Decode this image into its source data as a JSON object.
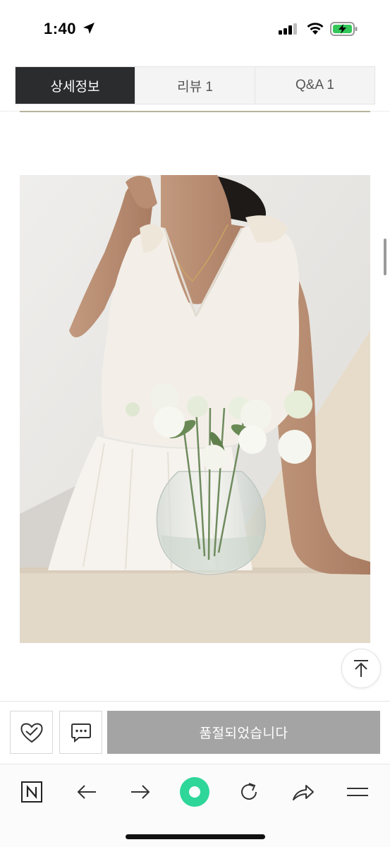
{
  "status_bar": {
    "time": "1:40",
    "icons": [
      "location-arrow-icon",
      "cellular-signal-icon",
      "wifi-icon",
      "battery-charging-icon"
    ]
  },
  "tabs": [
    {
      "label": "상세정보",
      "active": true
    },
    {
      "label": "리뷰 1",
      "active": false
    },
    {
      "label": "Q&A 1",
      "active": false
    }
  ],
  "purchase_bar": {
    "wish_icon": "heart-check-icon",
    "talk_icon": "chat-bubble-icon",
    "button_label": "품절되었습니다"
  },
  "scroll_top_icon": "arrow-up-to-top-icon",
  "browser_toolbar": {
    "items": [
      "naver-logo-icon",
      "back-arrow-icon",
      "forward-arrow-icon",
      "green-dot-icon",
      "reload-icon",
      "share-icon",
      "menu-icon"
    ]
  },
  "colors": {
    "active_tab_bg": "#2a2c2d",
    "soldout_bg": "#a4a4a4",
    "green_dot": "#2ed69a"
  }
}
